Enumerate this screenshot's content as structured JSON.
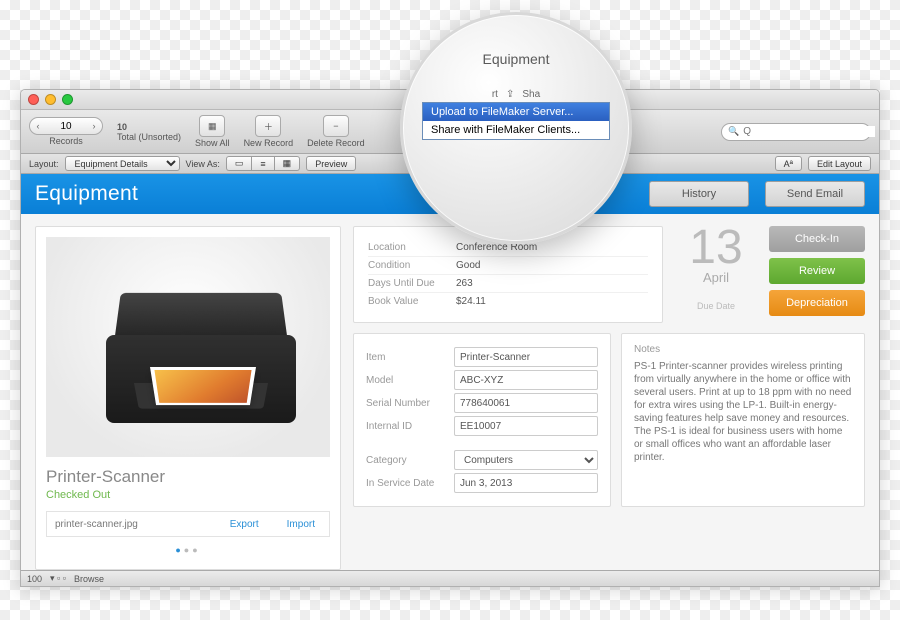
{
  "window": {
    "title": "Equipment"
  },
  "toolbar": {
    "record_index": "10",
    "records_count": "10",
    "records_label": "Total (Unsorted)",
    "records_caption": "Records",
    "show_all": "Show All",
    "new_record": "New Record",
    "delete_record": "Delete Record",
    "search_placeholder": "Q"
  },
  "subbar": {
    "layout_label": "Layout:",
    "layout_value": "Equipment Details",
    "view_as": "View As:",
    "preview": "Preview",
    "aa": "Aª",
    "edit_layout": "Edit Layout"
  },
  "header": {
    "title": "Equipment",
    "history": "History",
    "send_email": "Send Email"
  },
  "left": {
    "title": "Printer-Scanner",
    "status": "Checked Out",
    "filename": "printer-scanner.jpg",
    "export": "Export",
    "import": "Import"
  },
  "info": {
    "rows": [
      {
        "k": "Location",
        "v": "Conference Room"
      },
      {
        "k": "Condition",
        "v": "Good"
      },
      {
        "k": "Days Until Due",
        "v": "263"
      },
      {
        "k": "Book Value",
        "v": "$24.11"
      }
    ]
  },
  "date": {
    "day": "13",
    "month": "April",
    "label": "Due Date"
  },
  "actions": {
    "checkin": "Check-In",
    "review": "Review",
    "depreciation": "Depreciation"
  },
  "form": {
    "item_label": "Item",
    "item": "Printer-Scanner",
    "model_label": "Model",
    "model": "ABC-XYZ",
    "serial_label": "Serial Number",
    "serial": "778640061",
    "internal_label": "Internal ID",
    "internal": "EE10007",
    "category_label": "Category",
    "category": "Computers",
    "service_label": "In Service Date",
    "service": "Jun 3, 2013"
  },
  "notes": {
    "heading": "Notes",
    "body": "PS-1 Printer-scanner provides wireless printing from virtually anywhere in the home or office with several users. Print at up to 18 ppm with no need for extra wires using the LP-1. Built-in energy-saving features help save money and resources. The PS-1 is ideal for business users with home or small offices who want an affordable laser printer."
  },
  "statusbar": {
    "zoom": "100",
    "mode": "Browse"
  },
  "magnifier": {
    "title": "Equipment",
    "tab_rt": "rt",
    "tab_sha": "Sha",
    "menu_upload": "Upload to FileMaker Server...",
    "menu_share": "Share with FileMaker Clients..."
  }
}
